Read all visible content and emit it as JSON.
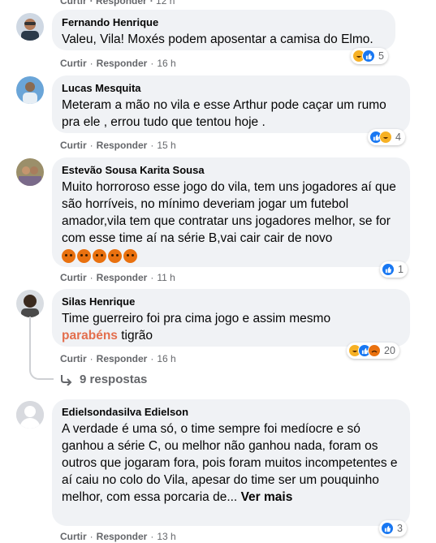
{
  "top_actions": {
    "like": "Curtir",
    "reply": "Responder",
    "time": "12 h"
  },
  "comments": [
    {
      "author": "Fernando Henrique",
      "text": "Valeu, Vila! Moxés podem aposentar a camisa do Elmo.",
      "actions": {
        "like": "Curtir",
        "reply": "Responder",
        "time": "16 h"
      },
      "reaction_count": "5",
      "reaction_types": [
        "haha",
        "like"
      ]
    },
    {
      "author": "Lucas Mesquita",
      "text": "Meteram a mão no vila e esse Arthur pode caçar um rumo pra ele , errou tudo que tentou hoje .",
      "actions": {
        "like": "Curtir",
        "reply": "Responder",
        "time": "15 h"
      },
      "reaction_count": "4",
      "reaction_types": [
        "like",
        "haha"
      ]
    },
    {
      "author": "Estevão Sousa Karita Sousa",
      "text": "Muito horroroso esse jogo do vila, tem uns jogadores aí que são horríveis, no mínimo deveriam jogar um futebol amador,vila tem que contratar uns jogadores melhor, se for com esse time aí na série B,vai cair cair de novo",
      "emoji_icon": "angry-face-emoji",
      "emoji_repeat": 5,
      "actions": {
        "like": "Curtir",
        "reply": "Responder",
        "time": "11 h"
      },
      "reaction_count": "1",
      "reaction_types": [
        "like"
      ]
    },
    {
      "author": "Silas Henrique",
      "text": "Time guerreiro foi pra cima jogo e assim mesmo",
      "highlight": "parabéns",
      "text_after": " tigrão",
      "actions": {
        "like": "Curtir",
        "reply": "Responder",
        "time": "16 h"
      },
      "reaction_count": "20",
      "reaction_types": [
        "haha",
        "like",
        "angry"
      ],
      "replies_label": "9 respostas"
    },
    {
      "author": "Edielsondasilva Edielson",
      "text": "A verdade é uma só, o time sempre foi medíocre e só ganhou a série C, ou melhor não ganhou nada, foram os outros que jogaram fora, pois foram muitos incompetentes e aí caiu no colo do Vila, apesar do time ser um pouquinho melhor, com essa porcaria de...",
      "see_more": "Ver mais",
      "actions": {
        "like": "Curtir",
        "reply": "Responder",
        "time": "13 h"
      },
      "reaction_count": "3",
      "reaction_types": [
        "like"
      ]
    }
  ],
  "colors": {
    "bubble": "#f0f2f5",
    "meta": "#65676b",
    "like": "#1877f2",
    "haha": "#f7b125",
    "angry": "#e9710f",
    "highlight": "#e36e4d"
  },
  "icons": {
    "like": "thumbs-up-icon",
    "haha": "laughing-face-icon",
    "angry": "angry-face-icon",
    "reply_arrow": "reply-arrow-icon",
    "avatar_default": "default-avatar-icon"
  }
}
